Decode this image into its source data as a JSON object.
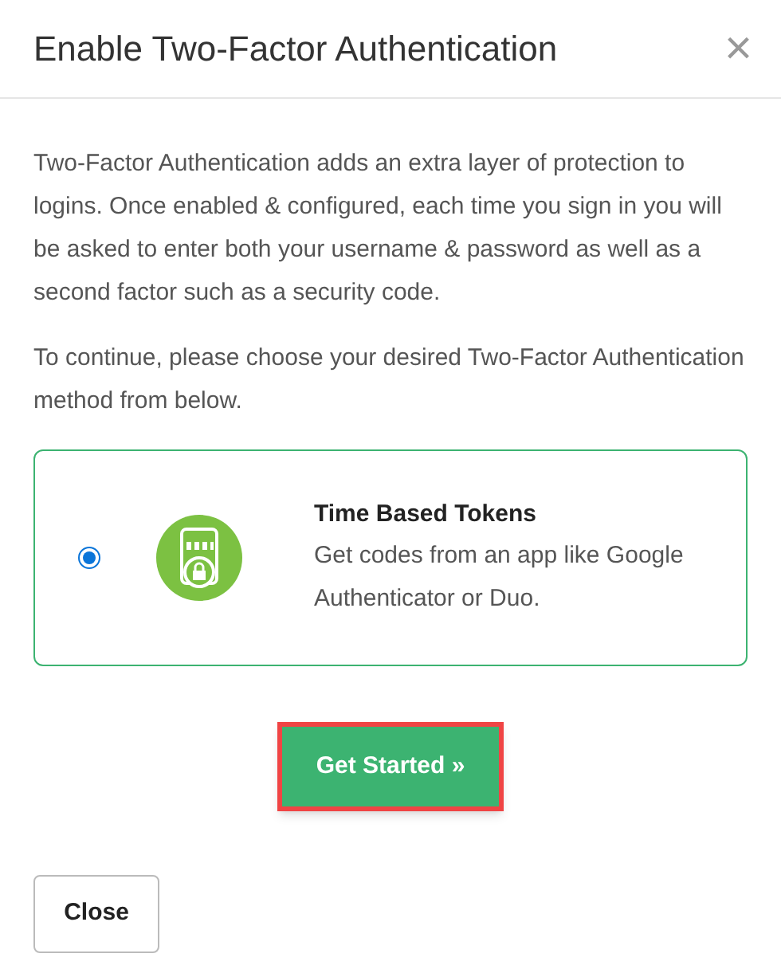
{
  "dialog": {
    "title": "Enable Two-Factor Authentication",
    "close_icon": "×"
  },
  "paragraphs": [
    "Two-Factor Authentication adds an extra layer of protection to logins. Once enabled & configured, each time you sign in you will be asked to enter both your username & password as well as a second factor such as a security code.",
    "To continue, please choose your desired Two-Factor Authentication method from below."
  ],
  "methods": [
    {
      "title": "Time Based Tokens",
      "description": "Get codes from an app like Google Authenticator or Duo.",
      "selected": true
    }
  ],
  "primary_button": {
    "label": "Get Started »",
    "highlighted": true
  },
  "footer_button": {
    "label": "Close"
  }
}
